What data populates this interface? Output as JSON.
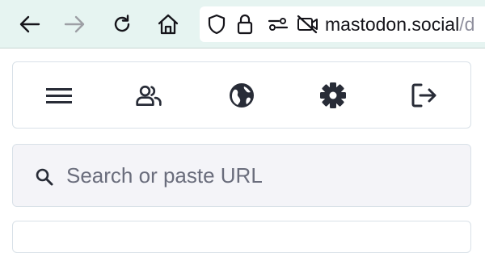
{
  "browser": {
    "back_icon": "arrow-left-icon",
    "forward_icon": "arrow-right-icon",
    "reload_icon": "reload-icon",
    "home_icon": "home-icon",
    "url_host": "mastodon.social",
    "url_rest": "/d",
    "url_icons": [
      "shield-icon",
      "lock-icon",
      "permissions-icon",
      "no-camera-icon"
    ]
  },
  "nav_panel": {
    "buttons": [
      "menu-icon",
      "people-icon",
      "globe-icon",
      "gear-icon",
      "logout-icon"
    ]
  },
  "search": {
    "placeholder": "Search or paste URL",
    "value": ""
  },
  "colors": {
    "toolbar_bg": "#e6f4f1",
    "icon_dark": "#282c37",
    "panel_border": "#d9e1e8",
    "search_bg": "#f4f4f8",
    "placeholder": "#6a6d7c"
  }
}
